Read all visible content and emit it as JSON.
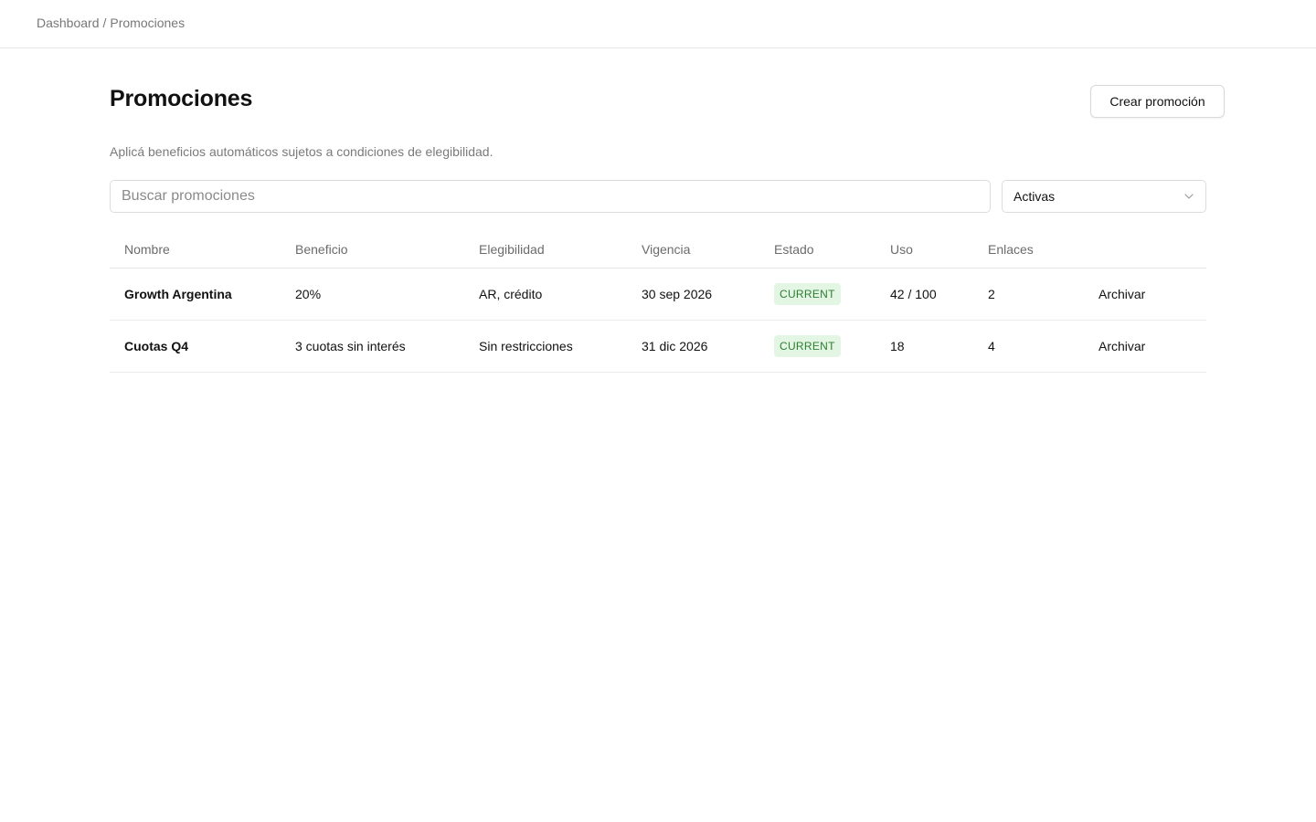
{
  "breadcrumb": {
    "root": "Dashboard",
    "separator": "/",
    "current": "Promociones"
  },
  "header": {
    "title": "Promociones",
    "create_label": "Crear promoción",
    "subtitle": "Aplicá beneficios automáticos sujetos a condiciones de elegibilidad."
  },
  "filters": {
    "search_placeholder": "Buscar promociones",
    "status_selected": "Activas"
  },
  "table": {
    "columns": {
      "nombre": "Nombre",
      "beneficio": "Beneficio",
      "elegibilidad": "Elegibilidad",
      "vigencia": "Vigencia",
      "estado": "Estado",
      "uso": "Uso",
      "enlaces": "Enlaces"
    },
    "rows": [
      {
        "nombre": "Growth Argentina",
        "beneficio": "20%",
        "elegibilidad": "AR, crédito",
        "vigencia": "30 sep 2026",
        "estado": "CURRENT",
        "uso": "42 / 100",
        "enlaces": "2",
        "action": "Archivar"
      },
      {
        "nombre": "Cuotas Q4",
        "beneficio": "3 cuotas sin interés",
        "elegibilidad": "Sin restricciones",
        "vigencia": "31 dic 2026",
        "estado": "CURRENT",
        "uso": "18",
        "enlaces": "4",
        "action": "Archivar"
      }
    ]
  },
  "colors": {
    "badge_bg": "#e3f5e3",
    "badge_text": "#2e7d32",
    "border": "#e6e6e6",
    "muted_text": "#777777"
  },
  "icons": {
    "select_chevron": "chevron-down-icon"
  }
}
